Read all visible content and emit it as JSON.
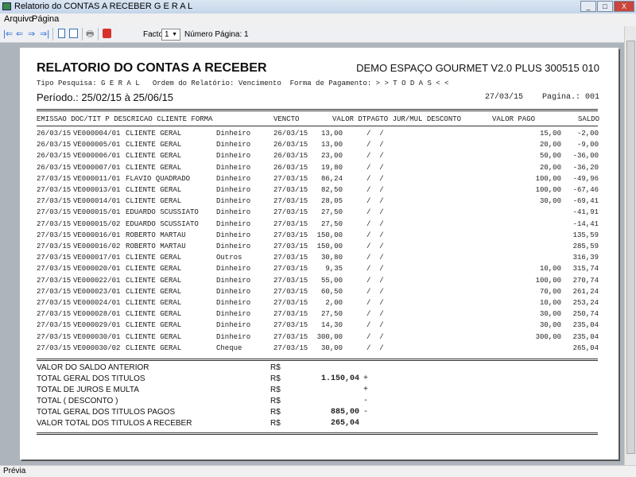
{
  "window": {
    "title": "Relatorio do CONTAS A RECEBER G E R A L",
    "buttons": [
      "_",
      "□",
      "X"
    ]
  },
  "menu": [
    "Arquivo",
    "Página"
  ],
  "toolbar": {
    "factor_label": "Factor:",
    "factor_value": "1",
    "page_label": "Número Página: 1",
    "icons": [
      "first-page-icon",
      "prev-page-icon",
      "next-page-icon",
      "last-page-icon",
      "single-page-icon",
      "two-page-icon",
      "print-icon",
      "close-report-icon"
    ]
  },
  "report": {
    "title": "RELATORIO DO CONTAS A RECEBER",
    "company": "DEMO ESPAÇO GOURMET V2.0 PLUS 300515 010",
    "filters": "Tipo Pesquisa: G E R A L   Ordem do Relatório: Vencimento  Forma de Pagamento: > > T O D A S < <",
    "period": "Período.: 25/02/15 à 25/06/15",
    "date": "27/03/15",
    "page": "Pagina.: 001",
    "columns": {
      "left": "EMISSAO DOC/TIT P DESCRICAO CLIENTE FORMA",
      "vencto": "VENCTO",
      "mid": "VALOR DTPAGTO JUR/MUL DESCONTO",
      "pago": "VALOR PAGO",
      "saldo": "SALDO"
    },
    "rows": [
      [
        "26/03/15",
        "VE000004/01",
        "CLIENTE GERAL",
        "Dinheiro",
        "26/03/15",
        "13,00",
        "/  /",
        "15,00",
        "-2,00"
      ],
      [
        "26/03/15",
        "VE000005/01",
        "CLIENTE GERAL",
        "Dinheiro",
        "26/03/15",
        "13,00",
        "/  /",
        "20,00",
        "-9,00"
      ],
      [
        "26/03/15",
        "VE000006/01",
        "CLIENTE GERAL",
        "Dinheiro",
        "26/03/15",
        "23,00",
        "/  /",
        "50,00",
        "-36,00"
      ],
      [
        "26/03/15",
        "VE000007/01",
        "CLIENTE GERAL",
        "Dinheiro",
        "26/03/15",
        "19,80",
        "/  /",
        "20,00",
        "-36,20"
      ],
      [
        "27/03/15",
        "VE000011/01",
        "FLAVIO QUADRADO",
        "Dinheiro",
        "27/03/15",
        "86,24",
        "/  /",
        "100,00",
        "-49,96"
      ],
      [
        "27/03/15",
        "VE000013/01",
        "CLIENTE GERAL",
        "Dinheiro",
        "27/03/15",
        "82,50",
        "/  /",
        "100,00",
        "-67,46"
      ],
      [
        "27/03/15",
        "VE000014/01",
        "CLIENTE GERAL",
        "Dinheiro",
        "27/03/15",
        "28,05",
        "/  /",
        "30,00",
        "-69,41"
      ],
      [
        "27/03/15",
        "VE000015/01",
        "EDUARDO SCUSSIATO",
        "Dinheiro",
        "27/03/15",
        "27,50",
        "/  /",
        "",
        "-41,91"
      ],
      [
        "27/03/15",
        "VE000015/02",
        "EDUARDO SCUSSIATO",
        "Dinheiro",
        "27/03/15",
        "27,50",
        "/  /",
        "",
        "-14,41"
      ],
      [
        "27/03/15",
        "VE000016/01",
        "ROBERTO MARTAU",
        "Dinheiro",
        "27/03/15",
        "150,00",
        "/  /",
        "",
        "135,59"
      ],
      [
        "27/03/15",
        "VE000016/02",
        "ROBERTO MARTAU",
        "Dinheiro",
        "27/03/15",
        "150,00",
        "/  /",
        "",
        "285,59"
      ],
      [
        "27/03/15",
        "VE000017/01",
        "CLIENTE GERAL",
        "Outros",
        "27/03/15",
        "30,80",
        "/  /",
        "",
        "316,39"
      ],
      [
        "27/03/15",
        "VE000020/01",
        "CLIENTE GERAL",
        "Dinheiro",
        "27/03/15",
        "9,35",
        "/  /",
        "10,00",
        "315,74"
      ],
      [
        "27/03/15",
        "VE000022/01",
        "CLIENTE GERAL",
        "Dinheiro",
        "27/03/15",
        "55,00",
        "/  /",
        "100,00",
        "270,74"
      ],
      [
        "27/03/15",
        "VE000023/01",
        "CLIENTE GERAL",
        "Dinheiro",
        "27/03/15",
        "60,50",
        "/  /",
        "70,00",
        "261,24"
      ],
      [
        "27/03/15",
        "VE000024/01",
        "CLIENTE GERAL",
        "Dinheiro",
        "27/03/15",
        "2,00",
        "/  /",
        "10,00",
        "253,24"
      ],
      [
        "27/03/15",
        "VE000028/01",
        "CLIENTE GERAL",
        "Dinheiro",
        "27/03/15",
        "27,50",
        "/  /",
        "30,00",
        "250,74"
      ],
      [
        "27/03/15",
        "VE000029/01",
        "CLIENTE GERAL",
        "Dinheiro",
        "27/03/15",
        "14,30",
        "/  /",
        "30,00",
        "235,04"
      ],
      [
        "27/03/15",
        "VE000030/01",
        "CLIENTE GERAL",
        "Dinheiro",
        "27/03/15",
        "300,00",
        "/  /",
        "300,00",
        "235,04"
      ],
      [
        "27/03/15",
        "VE000030/02",
        "CLIENTE GERAL",
        "Cheque",
        "27/03/15",
        "30,00",
        "/  /",
        "",
        "265,04"
      ]
    ],
    "summary": [
      {
        "label": "VALOR DO SALDO ANTERIOR",
        "cur": "R$",
        "value": "",
        "sign": ""
      },
      {
        "label": "TOTAL GERAL DOS TITULOS",
        "cur": "R$",
        "value": "1.150,04",
        "sign": "+"
      },
      {
        "label": "TOTAL DE JUROS E MULTA",
        "cur": "R$",
        "value": "",
        "sign": "+"
      },
      {
        "label": "TOTAL ( DESCONTO )",
        "cur": "R$",
        "value": "",
        "sign": "-"
      },
      {
        "label": "TOTAL GERAL DOS TITULOS PAGOS",
        "cur": "R$",
        "value": "885,00",
        "sign": "-"
      },
      {
        "label": "VALOR TOTAL DOS TITULOS A RECEBER",
        "cur": "R$",
        "value": "265,04",
        "sign": ""
      }
    ]
  },
  "status": "Prévia"
}
